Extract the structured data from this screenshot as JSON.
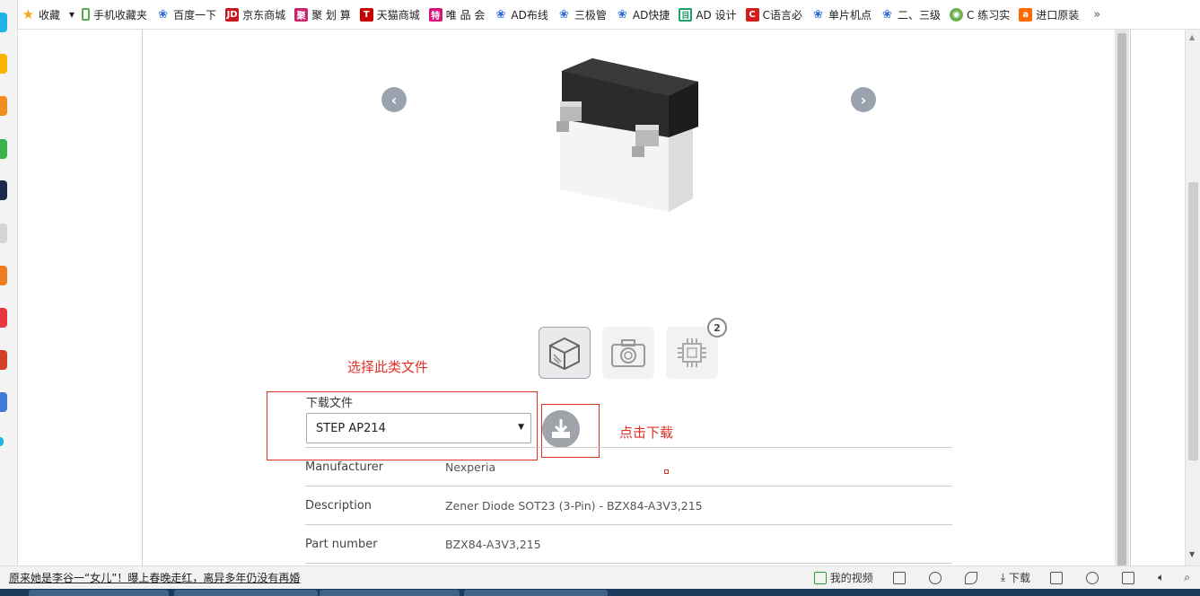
{
  "bookmarks": {
    "items": [
      {
        "label": "收藏",
        "icon": "star-icon",
        "color": "#f5a623"
      },
      {
        "label": "▾",
        "icon": "",
        "color": ""
      },
      {
        "label": "手机收藏夹",
        "icon": "phone-icon",
        "color": "#4cb050"
      },
      {
        "label": "百度一下",
        "icon": "paw-icon",
        "color": "#2f6bd8"
      },
      {
        "label": "京东商城",
        "icon": "jd-icon",
        "color": "#c8161d"
      },
      {
        "label": "聚 划 算",
        "icon": "juhuasuan-icon",
        "color": "#c8246d"
      },
      {
        "label": "天猫商城",
        "icon": "tmall-icon",
        "color": "#c40000"
      },
      {
        "label": "唯 品 会",
        "icon": "vip-icon",
        "color": "#d8157a"
      },
      {
        "label": "AD布线",
        "icon": "paw-icon",
        "color": "#2f6bd8"
      },
      {
        "label": "三极管",
        "icon": "paw-icon",
        "color": "#2f6bd8"
      },
      {
        "label": "AD快捷",
        "icon": "paw-icon",
        "color": "#2f6bd8"
      },
      {
        "label": "AD 设计",
        "icon": "doc-icon",
        "color": "#1aa06a"
      },
      {
        "label": "C语言必",
        "icon": "c-icon",
        "color": "#d01d1d"
      },
      {
        "label": "单片机点",
        "icon": "paw-icon",
        "color": "#2f6bd8"
      },
      {
        "label": "二、三级",
        "icon": "paw-icon",
        "color": "#2f6bd8"
      },
      {
        "label": "C 练习实",
        "icon": "globe-icon",
        "color": "#6ab04c"
      },
      {
        "label": "进口原装",
        "icon": "ali-icon",
        "color": "#ff6a00"
      }
    ],
    "more": "»"
  },
  "carousel": {
    "prev": "‹",
    "next": "›"
  },
  "thumbnails": {
    "badge_count": "2"
  },
  "annotations": {
    "select_note": "选择此类文件",
    "download_note": "点击下载"
  },
  "download": {
    "label": "下载文件",
    "selected_format": "STEP AP214"
  },
  "details": [
    {
      "key": "Manufacturer",
      "value": "Nexperia"
    },
    {
      "key": "Description",
      "value": "Zener Diode SOT23 (3-Pin) - BZX84-A3V3,215"
    },
    {
      "key": "Part number",
      "value": "BZX84-A3V3,215"
    }
  ],
  "statusbar": {
    "news": "原来她是李谷一“女儿”！曝上春晚走红，离异多年仍没有再婚",
    "my_video": "我的视频",
    "download": "下载"
  }
}
